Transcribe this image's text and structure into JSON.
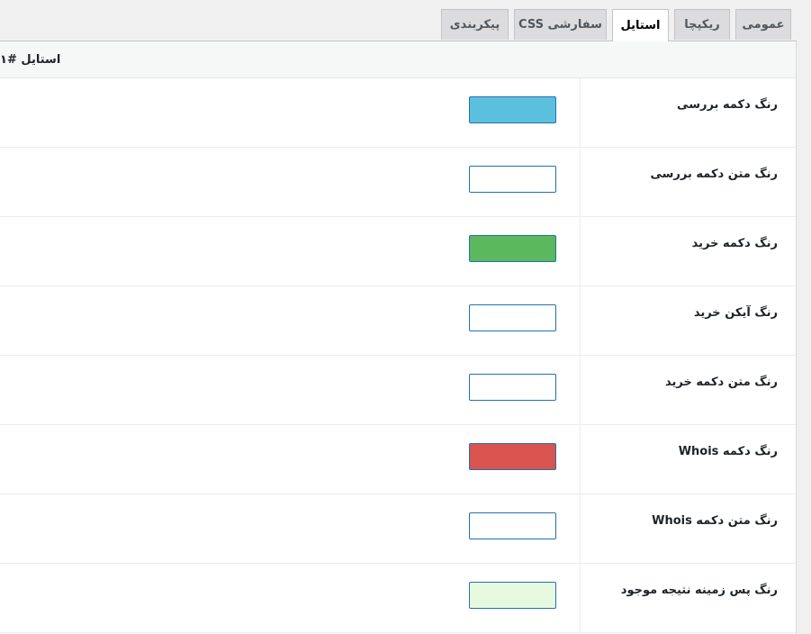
{
  "tabs": [
    {
      "label": "عمومی",
      "active": false
    },
    {
      "label": "ریکپچا",
      "active": false
    },
    {
      "label": "استایل",
      "active": true
    },
    {
      "label": "CSS سفارشی",
      "active": false
    },
    {
      "label": "پیکربندی",
      "active": false
    }
  ],
  "section": {
    "title": "استایل #۱"
  },
  "rows": [
    {
      "label": "رنگ دکمه بررسی",
      "color": "#5bc0de"
    },
    {
      "label": "رنگ متن دکمه بررسی",
      "color": "#ffffff"
    },
    {
      "label": "رنگ دکمه خرید",
      "color": "#5cb85c"
    },
    {
      "label": "رنگ آیکن خرید",
      "color": "#ffffff"
    },
    {
      "label": "رنگ متن دکمه خرید",
      "color": "#ffffff"
    },
    {
      "label": "رنگ دکمه Whois",
      "color": "#d9534f"
    },
    {
      "label": "رنگ متن دکمه Whois",
      "color": "#ffffff"
    },
    {
      "label": "رنگ پس زمینه نتیجه موجود",
      "color": "#e6f9df"
    }
  ]
}
